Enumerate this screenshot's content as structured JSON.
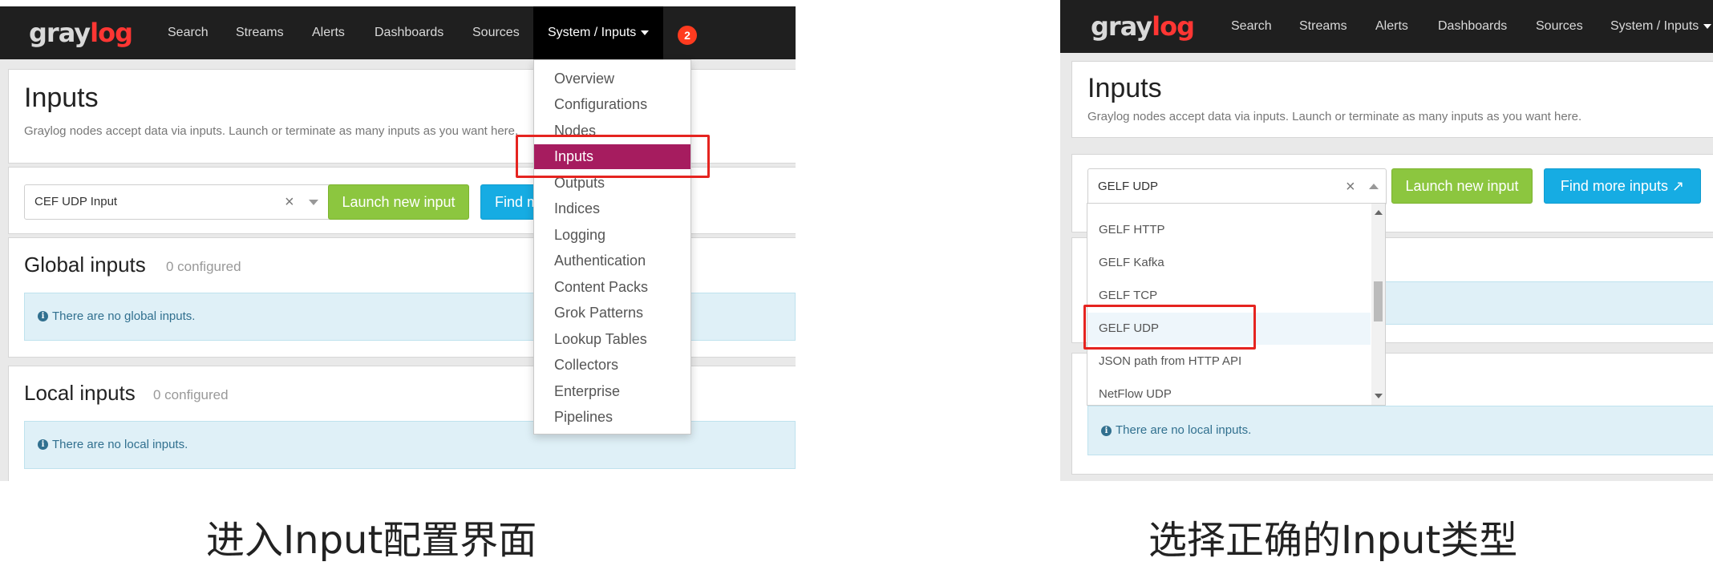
{
  "left": {
    "logo": {
      "part1": "gray",
      "part2": "log"
    },
    "nav": [
      "Search",
      "Streams",
      "Alerts",
      "Dashboards",
      "Sources"
    ],
    "nav_active": "System / Inputs",
    "notification_count": "2",
    "page_title": "Inputs",
    "subtitle": "Graylog nodes accept data via inputs. Launch or terminate as many inputs as you want here.",
    "select_value": "CEF UDP Input",
    "launch_button": "Launch new input",
    "find_button_partial": "Find m",
    "global_title": "Global inputs",
    "global_count": "0 configured",
    "global_info": "There are no global inputs.",
    "local_title": "Local inputs",
    "local_count": "0 configured",
    "local_info": "There are no local inputs.",
    "dropdown": [
      "Overview",
      "Configurations",
      "Nodes",
      "Inputs",
      "Outputs",
      "Indices",
      "Logging",
      "Authentication",
      "Content Packs",
      "Grok Patterns",
      "Lookup Tables",
      "Collectors",
      "Enterprise",
      "Pipelines"
    ],
    "dropdown_selected": "Inputs"
  },
  "right": {
    "logo": {
      "part1": "gray",
      "part2": "log"
    },
    "nav": [
      "Search",
      "Streams",
      "Alerts",
      "Dashboards",
      "Sources"
    ],
    "nav_active": "System / Inputs",
    "page_title": "Inputs",
    "subtitle": "Graylog nodes accept data via inputs. Launch or terminate as many inputs as you want here.",
    "select_value": "GELF UDP",
    "launch_button": "Launch new input",
    "find_button": "Find more inputs",
    "options": [
      "GELF HTTP",
      "GELF Kafka",
      "GELF TCP",
      "GELF UDP",
      "JSON path from HTTP API",
      "NetFlow UDP"
    ],
    "option_highlighted": "GELF UDP",
    "local_info": "There are no local inputs."
  },
  "captions": {
    "left": "进入Input配置界面",
    "right": "选择正确的Input类型"
  },
  "colors": {
    "navbar": "#1f1f1f",
    "logo_red": "#ff3633",
    "selected_menu": "#a61c5f",
    "launch_green": "#8cc63f",
    "find_blue": "#16ace3",
    "annotation_red": "#e52420",
    "info_bg": "#dff0f7"
  },
  "icons": [
    "caret-down-icon",
    "info-icon",
    "clear-icon",
    "external-link-icon",
    "scroll-up-icon",
    "scroll-down-icon"
  ]
}
